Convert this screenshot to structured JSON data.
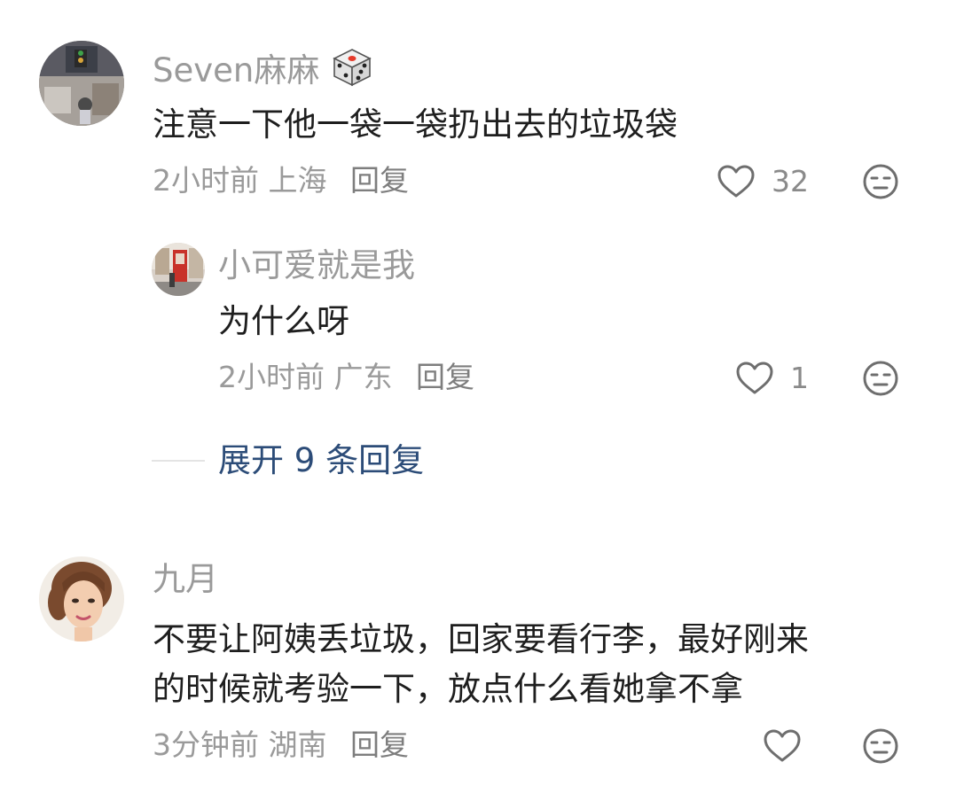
{
  "comments": [
    {
      "user": "Seven麻麻",
      "name_emoji": "dice-icon",
      "text": "注意一下他一袋一袋扔出去的垃圾袋",
      "time": "2小时前",
      "location": "上海",
      "reply_label": "回复",
      "likes": "32",
      "replies": [
        {
          "user": "小可爱就是我",
          "text": "为什么呀",
          "time": "2小时前",
          "location": "广东",
          "reply_label": "回复",
          "likes": "1"
        }
      ],
      "expand_label": "展开 9 条回复"
    },
    {
      "user": "九月",
      "text_line1": "不要让阿姨丢垃圾，回家要看行李，最好刚来",
      "text_line2": "的时候就考验一下，放点什么看她拿不拿",
      "time": "3分钟前",
      "location": "湖南",
      "reply_label": "回复",
      "likes": ""
    }
  ],
  "icons": {
    "like": "heart-outline-icon",
    "dislike": "neutral-face-icon"
  },
  "colors": {
    "name": "#9a9a9a",
    "text": "#1e1e1e",
    "expand_link": "#2c4c78"
  }
}
